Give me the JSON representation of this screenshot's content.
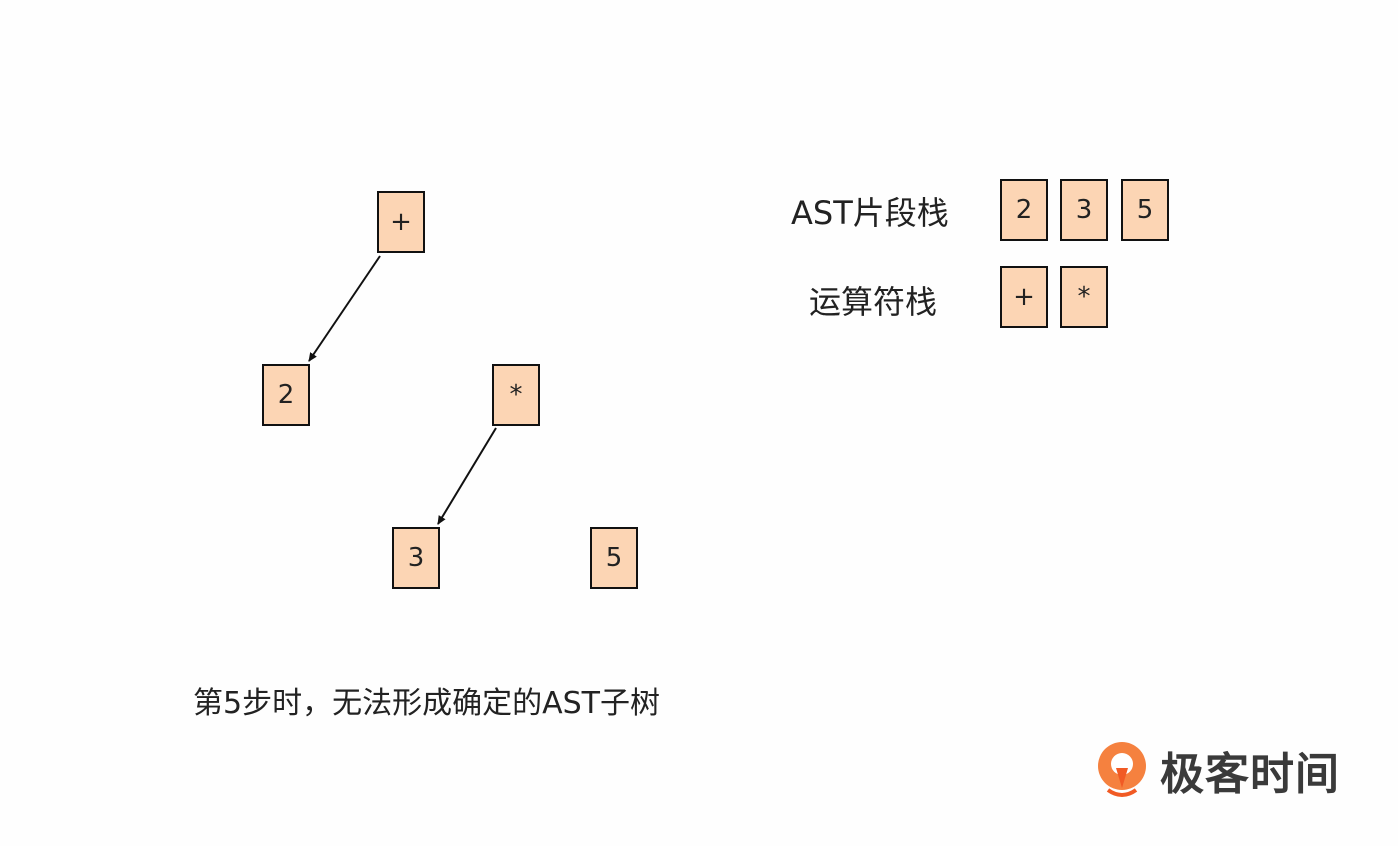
{
  "tree": {
    "nodes": [
      {
        "id": "plus",
        "text": "+"
      },
      {
        "id": "two",
        "text": "2"
      },
      {
        "id": "star",
        "text": "*"
      },
      {
        "id": "three",
        "text": "3"
      },
      {
        "id": "five",
        "text": "5"
      }
    ],
    "edges": [
      {
        "from": "plus",
        "to": "two"
      },
      {
        "from": "star",
        "to": "three"
      }
    ]
  },
  "ast_stack": {
    "label": "AST片段栈",
    "items": [
      "2",
      "3",
      "5"
    ]
  },
  "operator_stack": {
    "label": "运算符栈",
    "items": [
      "+",
      "*"
    ]
  },
  "caption": "第5步时，无法形成确定的AST子树",
  "logo": {
    "text": "极客时间",
    "icon": "geektime-logo-icon",
    "color_primary": "#f5813f",
    "color_secondary": "#f15a24"
  },
  "colors": {
    "node_fill": "#fcd5b4",
    "node_border": "#111111"
  }
}
